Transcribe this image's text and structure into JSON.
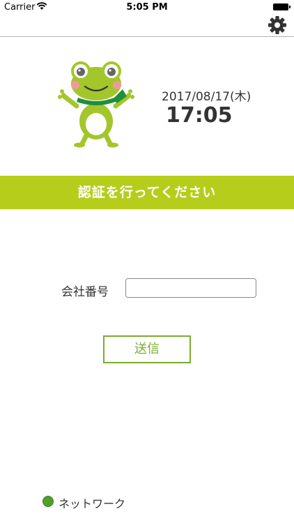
{
  "statusbar": {
    "carrier": "Carrier",
    "time": "5:05 PM"
  },
  "navbar": {
    "settings_icon": "gear-icon"
  },
  "header": {
    "date": "2017/08/17(木)",
    "clock": "17:05",
    "mascot": "frog-mascot"
  },
  "banner": {
    "text": "認証を行ってください",
    "color": "#b6cd1b"
  },
  "form": {
    "company_label": "会社番号",
    "company_value": "",
    "company_placeholder": "",
    "submit_label": "送信",
    "accent": "#7bab2e"
  },
  "footer": {
    "network_label": "ネットワーク",
    "status_color": "#4f9f2a"
  }
}
